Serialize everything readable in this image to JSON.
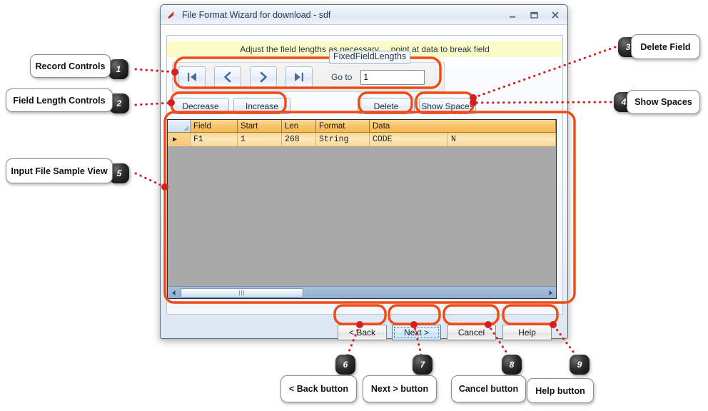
{
  "window": {
    "title": "File Format Wizard for download - sdf",
    "icon": "app-arrow-icon",
    "minimize_label": "Minimize",
    "maximize_label": "Maximize",
    "close_label": "Close"
  },
  "groupbox": {
    "label": "FixedFieldLengths"
  },
  "banner": {
    "text": "Adjust the field lengths as necessary ... point at data to break field"
  },
  "record_controls": {
    "first_label": "First record",
    "prev_label": "Previous record",
    "next_label": "Next record",
    "last_label": "Last record",
    "goto_label": "Go to",
    "goto_value": "1",
    "goto_placeholder": ""
  },
  "toolbar": {
    "decrease_label": "Decrease",
    "increase_label": "Increase",
    "delete_label": "Delete",
    "show_spaces_label": "Show Spaces"
  },
  "grid": {
    "columns": [
      "",
      "Field",
      "Start",
      "Len",
      "Format",
      "Data"
    ],
    "rows": [
      {
        "selector": "▶",
        "field": "F1",
        "start": "1",
        "len": "268",
        "format": "String",
        "data": "CODE",
        "data_extra": "N"
      }
    ],
    "scroll_left_label": "Scroll left",
    "scroll_right_label": "Scroll right"
  },
  "dialog_buttons": {
    "back_label": "< Back",
    "next_label": "Next >",
    "cancel_label": "Cancel",
    "help_label": "Help"
  },
  "annotations": {
    "accent_color": "#f04a16",
    "items": [
      {
        "number": "1",
        "label": "Record Controls"
      },
      {
        "number": "2",
        "label": "Field Length Controls"
      },
      {
        "number": "3",
        "label": "Delete Field"
      },
      {
        "number": "4",
        "label": "Show Spaces"
      },
      {
        "number": "5",
        "label": "Input File Sample View"
      },
      {
        "number": "6",
        "label": "< Back button"
      },
      {
        "number": "7",
        "label": "Next > button"
      },
      {
        "number": "8",
        "label": "Cancel button"
      },
      {
        "number": "9",
        "label": "Help button"
      }
    ]
  }
}
